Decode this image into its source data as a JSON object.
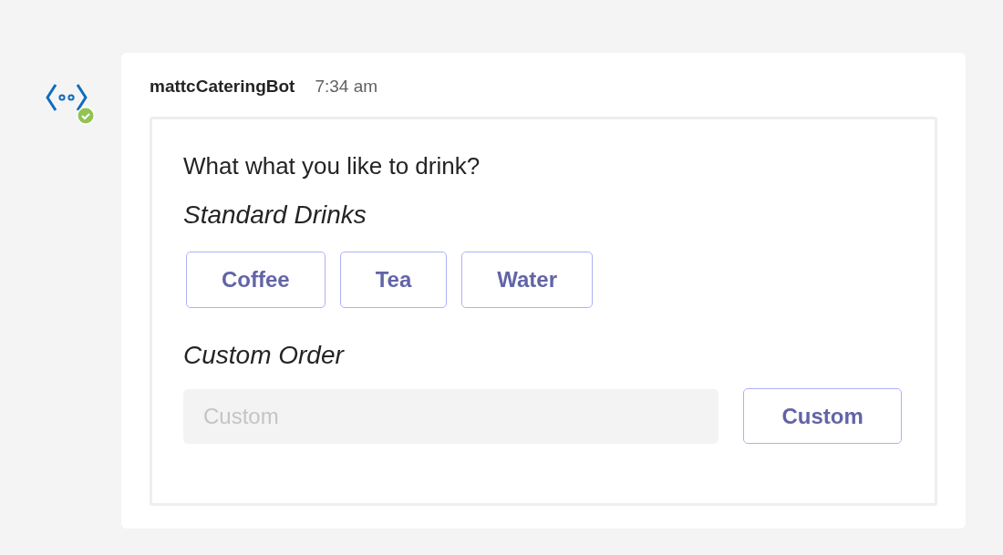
{
  "message": {
    "sender": "mattcCateringBot",
    "time": "7:34 am"
  },
  "card": {
    "title": "What what you like to drink?",
    "sections": [
      {
        "kind": "choices",
        "heading": "Standard Drinks",
        "buttons": [
          "Coffee",
          "Tea",
          "Water"
        ]
      },
      {
        "kind": "input",
        "heading": "Custom Order",
        "placeholder": "Custom",
        "button": "Custom"
      }
    ]
  }
}
